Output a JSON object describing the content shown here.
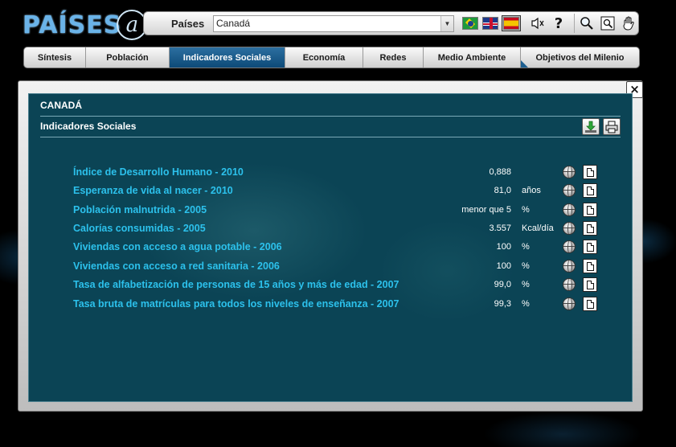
{
  "header": {
    "logo_text": "PAÍSES",
    "logo_mark": "a",
    "countries_label": "Países",
    "selected_country": "Canadá",
    "icons": [
      "brazil-flag-icon",
      "uk-flag-icon",
      "spain-flag-icon",
      "speaker-icon",
      "help-icon",
      "zoom-icon",
      "zoom-area-icon",
      "pan-hand-icon"
    ]
  },
  "tabs": [
    {
      "label": "Síntesis",
      "active": false
    },
    {
      "label": "Población",
      "active": false
    },
    {
      "label": "Indicadores Sociales",
      "active": true
    },
    {
      "label": "Economía",
      "active": false
    },
    {
      "label": "Redes",
      "active": false
    },
    {
      "label": "Medio Ambiente",
      "active": false
    },
    {
      "label": "Objetivos del Milenio",
      "active": false
    }
  ],
  "panel": {
    "country": "CANADÁ",
    "section": "Indicadores Sociales",
    "close_label": "×"
  },
  "indicators": [
    {
      "label": "Índice de Desarrollo Humano - 2010",
      "value": "0,888",
      "unit": ""
    },
    {
      "label": "Esperanza de vida al nacer - 2010",
      "value": "81,0",
      "unit": "años"
    },
    {
      "label": "Población malnutrida - 2005",
      "value": "menor que 5",
      "unit": "%"
    },
    {
      "label": "Calorías consumidas - 2005",
      "value": "3.557",
      "unit": "Kcal/día"
    },
    {
      "label": "Viviendas con acceso a agua potable - 2006",
      "value": "100",
      "unit": "%"
    },
    {
      "label": "Viviendas con acceso a red sanitaria - 2006",
      "value": "100",
      "unit": "%"
    },
    {
      "label": "Tasa de alfabetización de personas de 15 años y más de edad - 2007",
      "value": "99,0",
      "unit": "%"
    },
    {
      "label": "Tasa bruta de matrículas para todos los niveles de enseñanza - 2007",
      "value": "99,3",
      "unit": "%"
    }
  ],
  "colors": {
    "panel_bg": "#0b4455",
    "link": "#2cc1ec",
    "active_tab": "#0d4a78"
  }
}
